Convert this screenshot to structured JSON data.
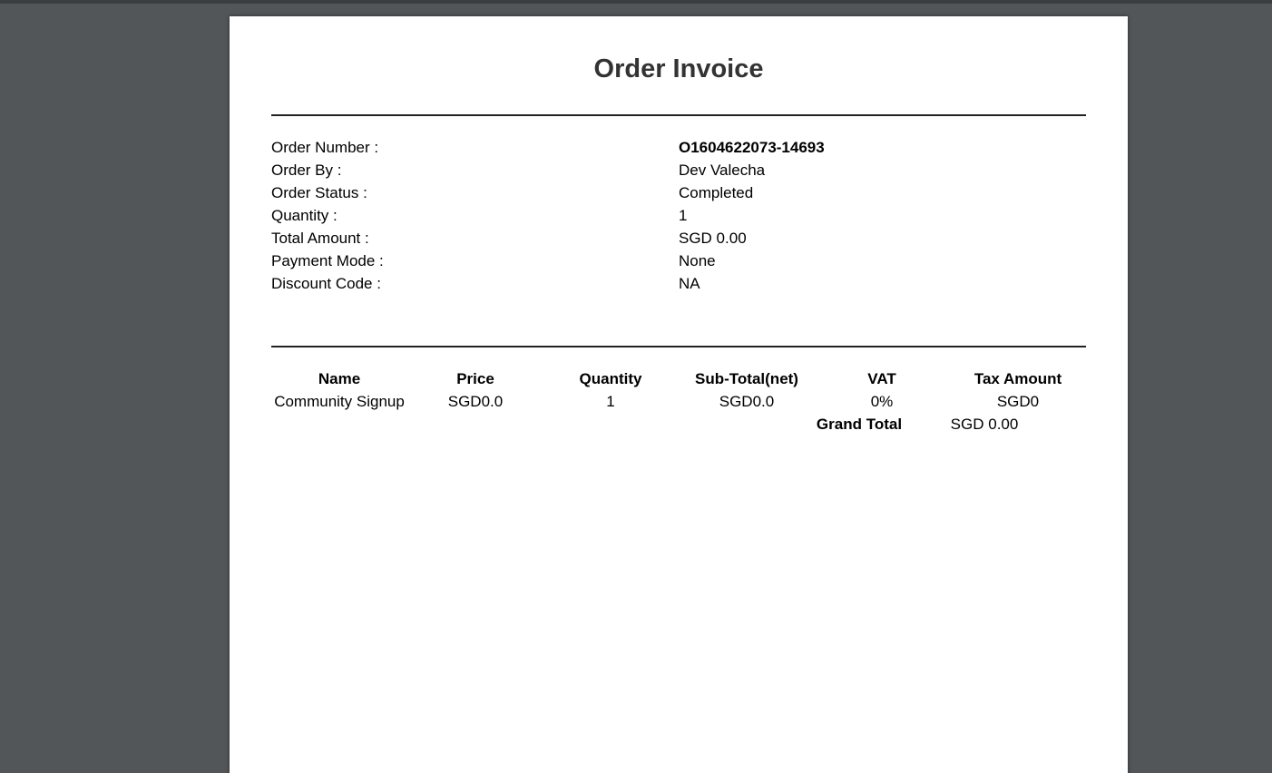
{
  "invoice": {
    "title": "Order Invoice",
    "details": [
      {
        "label": "Order Number :",
        "value": "O1604622073-14693"
      },
      {
        "label": "Order By :",
        "value": "Dev Valecha"
      },
      {
        "label": "Order Status :",
        "value": "Completed"
      },
      {
        "label": "Quantity :",
        "value": "1"
      },
      {
        "label": "Total Amount :",
        "value": "SGD 0.00"
      },
      {
        "label": "Payment Mode :",
        "value": "None"
      },
      {
        "label": "Discount Code :",
        "value": "NA"
      }
    ],
    "table": {
      "headers": [
        "Name",
        "Price",
        "Quantity",
        "Sub-Total(net)",
        "VAT",
        "Tax Amount"
      ],
      "rows": [
        [
          "Community Signup",
          "SGD0.0",
          "1",
          "SGD0.0",
          "0%",
          "SGD0"
        ]
      ],
      "grand_total_label": "Grand Total",
      "grand_total_value": "SGD 0.00"
    }
  }
}
